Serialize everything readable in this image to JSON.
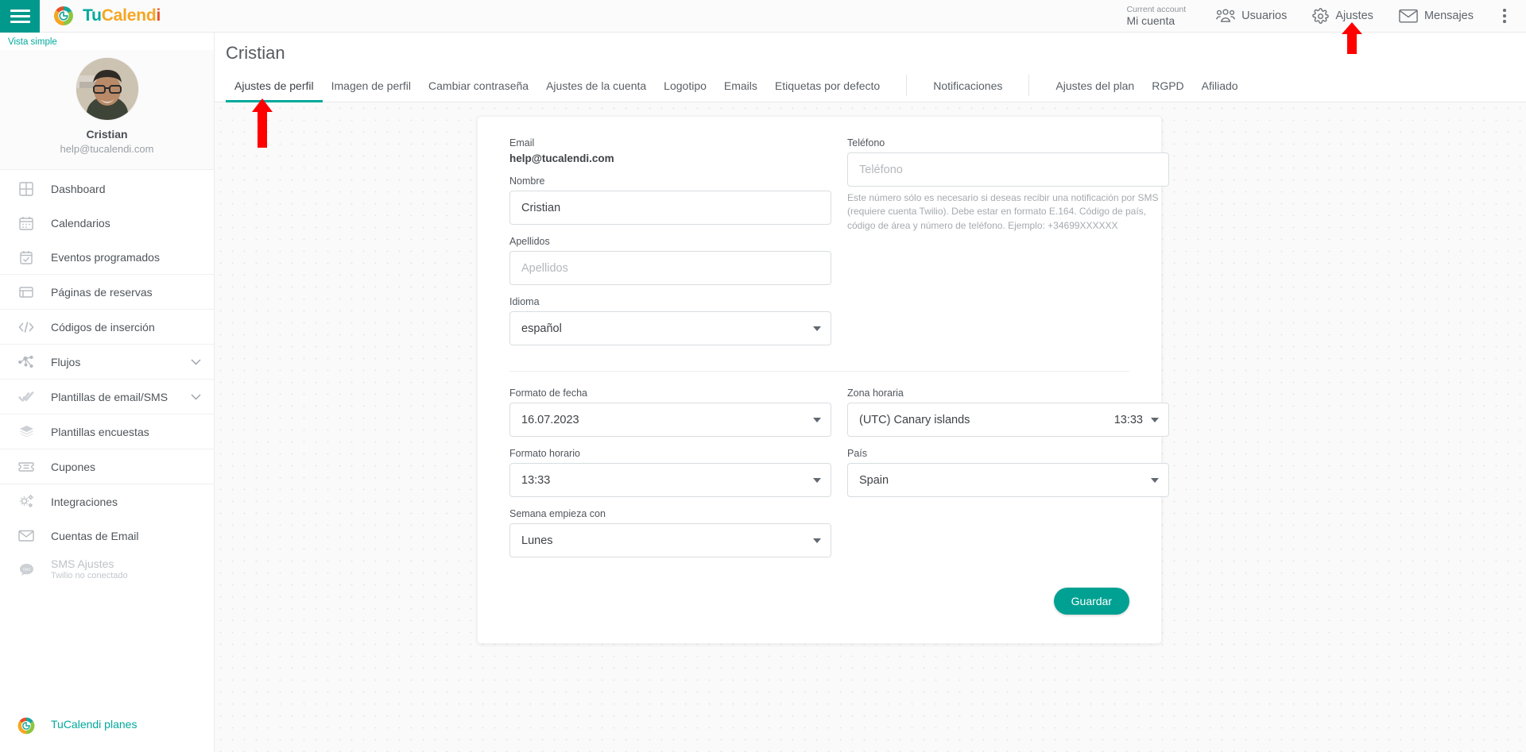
{
  "topbar": {
    "menu_icon": "hamburger-icon",
    "brand": {
      "part1": "Tu",
      "part2": "Calend",
      "part3": "i"
    },
    "account": {
      "label": "Current account",
      "value": "Mi cuenta"
    },
    "items": [
      {
        "label": "Usuarios",
        "icon": "users-icon"
      },
      {
        "label": "Ajustes",
        "icon": "gear-icon"
      },
      {
        "label": "Mensajes",
        "icon": "envelope-icon"
      }
    ],
    "overflow_icon": "kebab-menu-icon"
  },
  "sidebar": {
    "view_mode": "Vista simple",
    "profile": {
      "name": "Cristian",
      "email": "help@tucalendi.com",
      "avatar": "user-avatar"
    },
    "groups": [
      {
        "items": [
          {
            "label": "Dashboard",
            "icon": "dashboard-grid-icon"
          },
          {
            "label": "Calendarios",
            "icon": "calendar-icon"
          },
          {
            "label": "Eventos programados",
            "icon": "calendar-check-icon"
          }
        ]
      },
      {
        "items": [
          {
            "label": "Páginas de reservas",
            "icon": "window-icon"
          }
        ]
      },
      {
        "items": [
          {
            "label": "Códigos de inserción",
            "icon": "code-icon"
          }
        ]
      },
      {
        "items": [
          {
            "label": "Flujos",
            "icon": "flow-nodes-icon",
            "chevron": true
          }
        ]
      },
      {
        "items": [
          {
            "label": "Plantillas de email/SMS",
            "icon": "double-check-icon",
            "chevron": true
          }
        ]
      },
      {
        "items": [
          {
            "label": "Plantillas encuestas",
            "icon": "layers-icon"
          }
        ]
      },
      {
        "items": [
          {
            "label": "Cupones",
            "icon": "ticket-icon"
          }
        ]
      },
      {
        "items": [
          {
            "label": "Integraciones",
            "icon": "gears-icon"
          },
          {
            "label": "Cuentas de Email",
            "icon": "envelope-icon"
          },
          {
            "label": "SMS Ajustes",
            "sub": "Twilio no conectado",
            "icon": "sms-bubble-icon",
            "disabled": true
          }
        ]
      }
    ],
    "footer": {
      "label": "TuCalendi planes",
      "icon": "tucalendi-logo-icon"
    }
  },
  "main": {
    "page_title": "Cristian",
    "tabs": [
      {
        "label": "Ajustes de perfil",
        "active": true
      },
      {
        "label": "Imagen de perfil",
        "active": false
      },
      {
        "label": "Cambiar contraseña",
        "active": false
      },
      {
        "label": "Ajustes de la cuenta",
        "active": false
      },
      {
        "label": "Logotipo",
        "active": false
      },
      {
        "label": "Emails",
        "active": false
      },
      {
        "label": "Etiquetas por defecto",
        "active": false
      },
      {
        "separator": true
      },
      {
        "label": "Notificaciones",
        "active": false
      },
      {
        "separator": true
      },
      {
        "label": "Ajustes del plan",
        "active": false
      },
      {
        "label": "RGPD",
        "active": false
      },
      {
        "label": "Afiliado",
        "active": false
      }
    ],
    "form": {
      "email": {
        "label": "Email",
        "value": "help@tucalendi.com"
      },
      "nombre": {
        "label": "Nombre",
        "value": "Cristian",
        "placeholder": "Nombre"
      },
      "apellidos": {
        "label": "Apellidos",
        "value": "",
        "placeholder": "Apellidos"
      },
      "idioma": {
        "label": "Idioma",
        "value": "español"
      },
      "telefono": {
        "label": "Teléfono",
        "value": "",
        "placeholder": "Teléfono",
        "help": "Este número sólo es necesario si deseas recibir una notificación por SMS (requiere cuenta Twilio). Debe estar en formato E.164. Código de país, código de área y número de teléfono. Ejemplo: +34699XXXXXX"
      },
      "formato_fecha": {
        "label": "Formato de fecha",
        "value": "16.07.2023"
      },
      "formato_horario": {
        "label": "Formato horario",
        "value": "13:33"
      },
      "semana_empieza": {
        "label": "Semana empieza con",
        "value": "Lunes"
      },
      "zona_horaria": {
        "label": "Zona horaria",
        "value": "(UTC) Canary islands",
        "time": "13:33"
      },
      "pais": {
        "label": "País",
        "value": "Spain"
      },
      "save_label": "Guardar"
    }
  },
  "annotations": [
    {
      "name": "arrow-pointing-to-ajustes-de-perfil-tab",
      "color": "#FF0000"
    },
    {
      "name": "arrow-pointing-to-ajustes-menu",
      "color": "#FF0000"
    }
  ],
  "colors": {
    "accent": "#00A99D",
    "accent_dark": "#00998C",
    "save_button": "#00A192",
    "annotation": "#FF0000"
  }
}
